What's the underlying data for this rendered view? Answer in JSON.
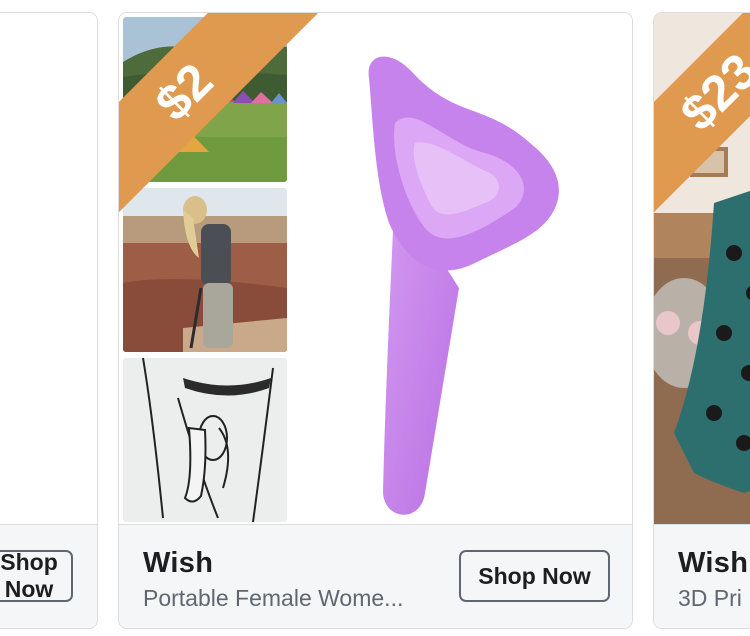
{
  "cards": [
    {
      "shop_label": "Shop Now"
    },
    {
      "price": "$2",
      "brand": "Wish",
      "description": "Portable Female Wome...",
      "shop_label": "Shop Now"
    },
    {
      "price": "$23",
      "brand": "Wish",
      "description": "3D Pri"
    }
  ],
  "colors": {
    "ribbon": "#e09a4f",
    "card_border": "#dadde1",
    "footer_bg": "#f5f6f7",
    "brand_text": "#1c1e21",
    "desc_text": "#606770",
    "product": "#c17ee8"
  }
}
